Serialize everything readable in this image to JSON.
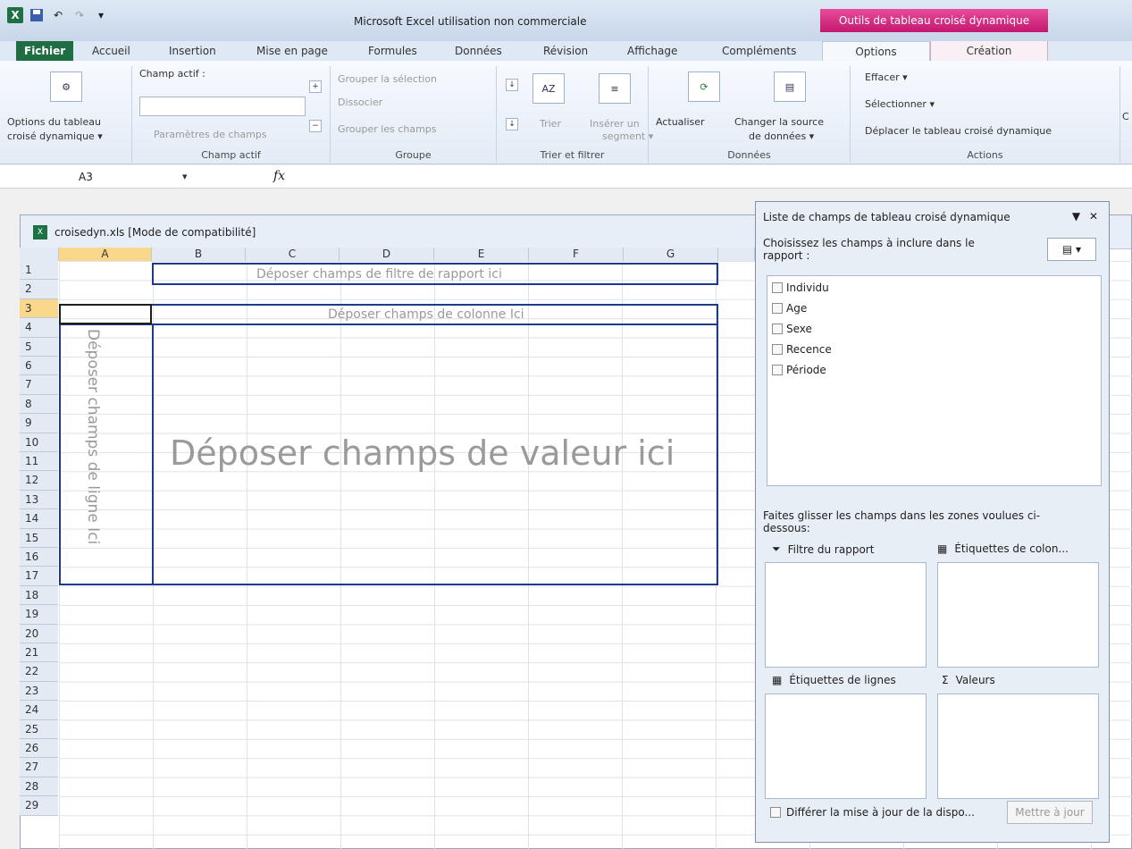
{
  "app": {
    "title": "Microsoft Excel utilisation non commerciale",
    "context_title": "Outils de tableau croisé dynamique"
  },
  "tabs": [
    "Fichier",
    "Accueil",
    "Insertion",
    "Mise en page",
    "Formules",
    "Données",
    "Révision",
    "Affichage",
    "Compléments",
    "Options",
    "Création"
  ],
  "ribbon": {
    "pivot_options_l1": "Options du tableau",
    "pivot_options_l2": "croisé dynamique ▾",
    "champ_actif_label": "Champ actif :",
    "parametres": "Paramètres de champs",
    "group_champ_actif": "Champ actif",
    "grouper_selection": "Grouper la sélection",
    "dissocier": "Dissocier",
    "grouper_champs": "Grouper les champs",
    "group_groupe": "Groupe",
    "trier": "Trier",
    "inserer_l1": "Insérer un",
    "inserer_l2": "segment ▾",
    "group_trier": "Trier et filtrer",
    "actualiser": "Actualiser",
    "changer_l1": "Changer la source",
    "changer_l2": "de données ▾",
    "group_donnees": "Données",
    "effacer": "Effacer ▾",
    "selectionner": "Sélectionner ▾",
    "deplacer": "Déplacer le tableau croisé dynamique",
    "group_actions": "Actions",
    "cut_letter": "C"
  },
  "formula_bar": {
    "name_box": "A3",
    "fx": "fx"
  },
  "workbook": {
    "title": "croisedyn.xls  [Mode de compatibilité]",
    "columns": [
      "A",
      "B",
      "C",
      "D",
      "E",
      "F",
      "G"
    ],
    "rows": [
      "1",
      "2",
      "3",
      "4",
      "5",
      "6",
      "7",
      "8",
      "9",
      "10",
      "11",
      "12",
      "13",
      "14",
      "15",
      "16",
      "17",
      "18",
      "19",
      "20",
      "21",
      "22",
      "23",
      "24",
      "25",
      "26",
      "27",
      "28",
      "29"
    ],
    "drop_filter": "Déposer champs de filtre de rapport ici",
    "drop_column": "Déposer champs de colonne Ici",
    "drop_row": "Déposer champs de ligne Ici",
    "drop_value": "Déposer champs de valeur ici"
  },
  "pane": {
    "title": "Liste de champs de tableau croisé dynamique",
    "choose": "Choisissez les champs à inclure dans le rapport :",
    "fields": [
      "Individu",
      "Age",
      "Sexe",
      "Recence",
      "Période"
    ],
    "drag_hint": "Faites glisser les champs dans les zones voulues ci-dessous:",
    "zone_filter": "Filtre du rapport",
    "zone_columns": "Étiquettes de colon...",
    "zone_rows": "Étiquettes de lignes",
    "zone_values": "Valeurs",
    "defer": "Différer la mise à jour de la dispo...",
    "update": "Mettre à jour"
  }
}
